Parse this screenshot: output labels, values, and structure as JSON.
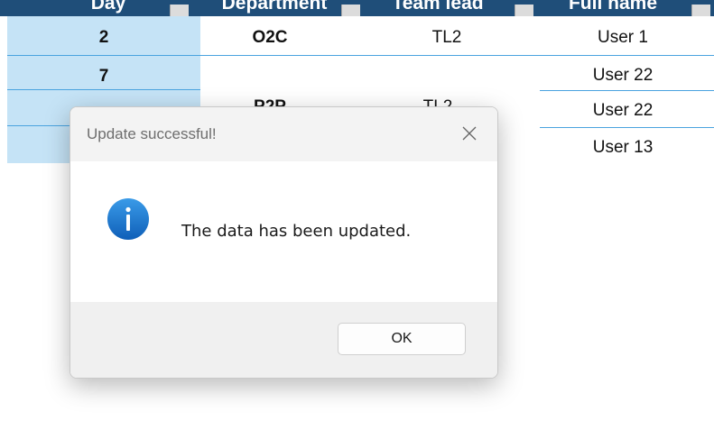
{
  "dialog": {
    "title": "Update successful!",
    "message": "The data has been updated.",
    "ok_label": "OK",
    "icon": "info-icon",
    "close_icon": "close-icon"
  },
  "sheet": {
    "header_fragments": [
      "Day",
      "Department",
      "Team lead",
      "Full name"
    ],
    "rows": [
      {
        "day": "2",
        "department": "O2C",
        "team_lead": "TL2",
        "user": "User 1"
      },
      {
        "day": "7",
        "department": "",
        "team_lead": "",
        "user": "User 22"
      },
      {
        "day": "",
        "department": "P2P",
        "team_lead": "TL2",
        "user": "User 22"
      },
      {
        "day": "",
        "department": "",
        "team_lead": "",
        "user": "User 13"
      }
    ]
  },
  "colors": {
    "header_bg": "#1f4e79",
    "day_column_bg": "#c5e3f6",
    "row_line": "#4aa3df",
    "info_icon": "#1a73c8"
  }
}
